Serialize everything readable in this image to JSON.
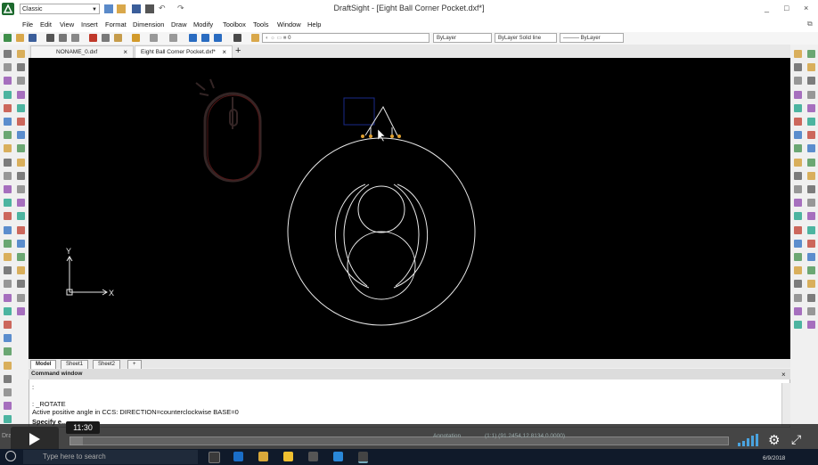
{
  "app": {
    "title": "DraftSight - [Eight Ball Corner Pocket.dxf*]",
    "workspace": "Classic",
    "window_controls": [
      "_",
      "□",
      "×"
    ]
  },
  "menu": [
    "File",
    "Edit",
    "View",
    "Insert",
    "Format",
    "Dimension",
    "Draw",
    "Modify",
    "Toolbox",
    "Tools",
    "Window",
    "Help"
  ],
  "toolbar": {
    "layer_value": "0",
    "color_value": "ByLayer",
    "linestyle_value": "ByLayer   Solid line",
    "lineweight_value": "——— ByLayer"
  },
  "tabs": [
    {
      "label": "NONAME_0.dxf",
      "close": "×"
    },
    {
      "label": "Eight Ball Corner Pocket.dxf*",
      "close": "×"
    }
  ],
  "tab_add": "+",
  "canvas": {
    "ucs_x": "X",
    "ucs_y": "Y",
    "background": "#000000",
    "geometry": "#e8e8e8"
  },
  "sheets": [
    "Model",
    "Sheet1",
    "Sheet2",
    "+"
  ],
  "command_window": {
    "title": "Command window",
    "close": "×",
    "lines": [
      ":",
      ": _ROTATE",
      "Active positive angle in CCS: DIRECTION=counterclockwise BASE=0",
      "Specify e..."
    ]
  },
  "player": {
    "timestamp": "11:30",
    "progress": 0.02
  },
  "statusbar": {
    "annotation": "Annotation",
    "coords": "(1:1)   (91.2454,12.8134,0.0000)"
  },
  "taskbar": {
    "search_placeholder": "Type here to search",
    "app_label": "DraftSight",
    "date": "6/9/2018"
  }
}
